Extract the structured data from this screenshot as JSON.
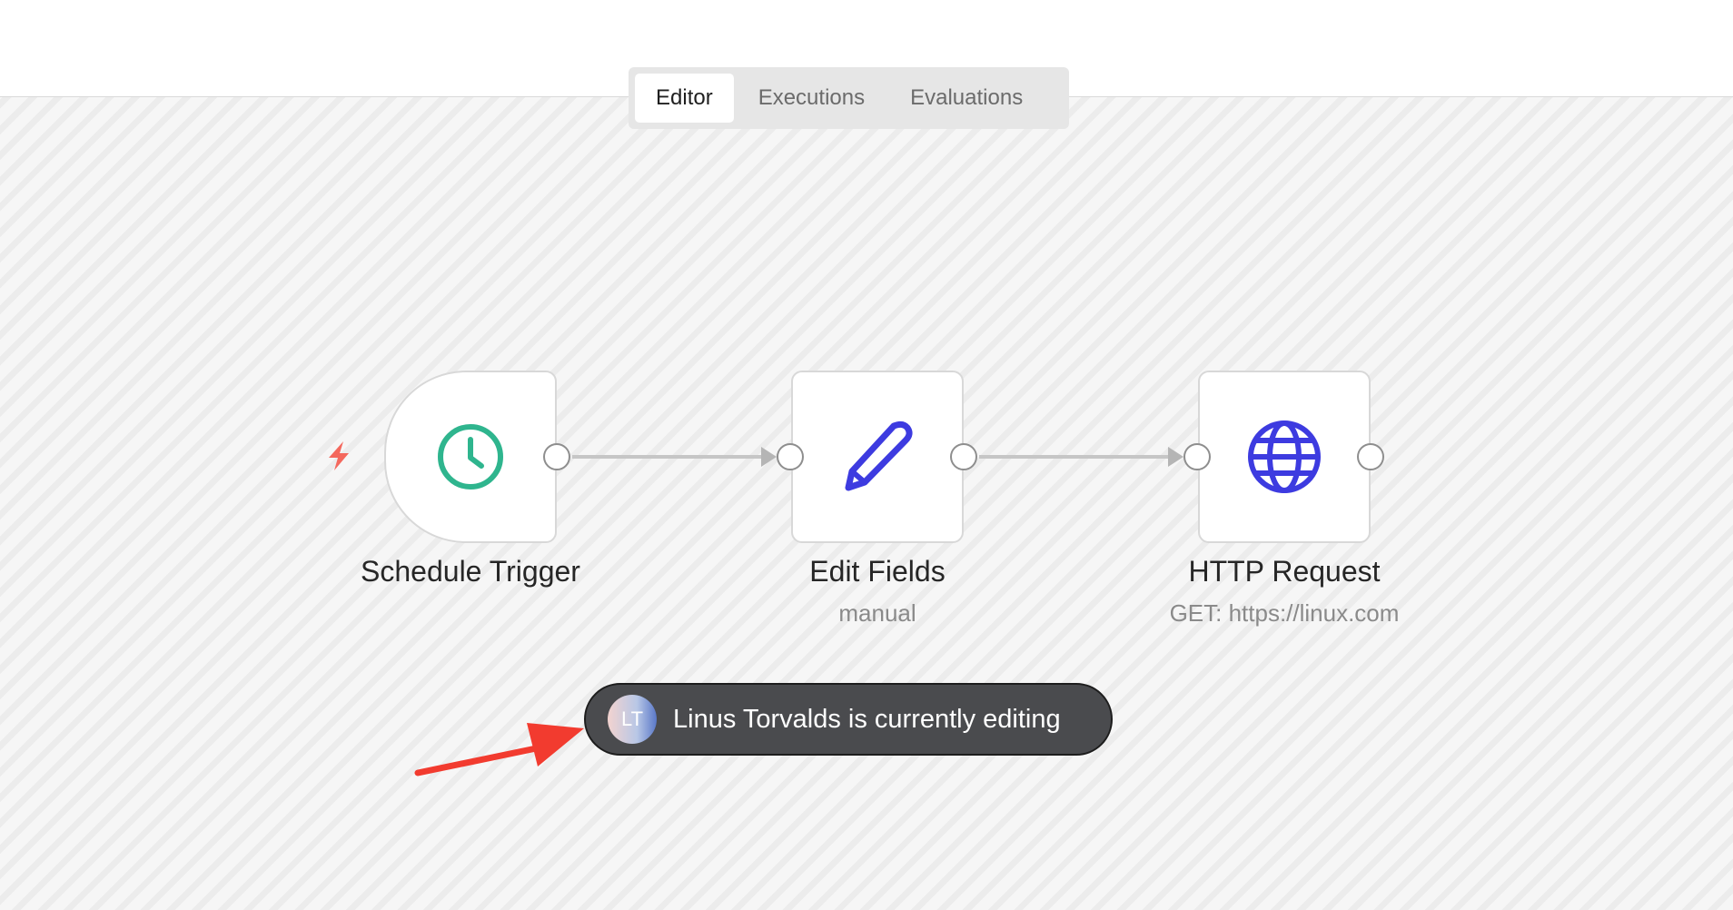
{
  "tabs": [
    {
      "label": "Editor",
      "active": true
    },
    {
      "label": "Executions",
      "active": false
    },
    {
      "label": "Evaluations",
      "active": false
    }
  ],
  "nodes": {
    "schedule": {
      "title": "Schedule Trigger",
      "icon": "clock-icon",
      "color": "#2fb58e"
    },
    "edit": {
      "title": "Edit Fields",
      "subtitle": "manual",
      "icon": "pencil-icon",
      "color": "#3d3be0"
    },
    "http": {
      "title": "HTTP Request",
      "subtitle": "GET: https://linux.com",
      "icon": "globe-icon",
      "color": "#3d3be0"
    }
  },
  "collab": {
    "avatar_initials": "LT",
    "message": "Linus Torvalds is currently editing"
  },
  "colors": {
    "trigger_bolt": "#f4685d",
    "annotation_arrow": "#f23b2f",
    "toast_bg": "#4a4b4e"
  }
}
